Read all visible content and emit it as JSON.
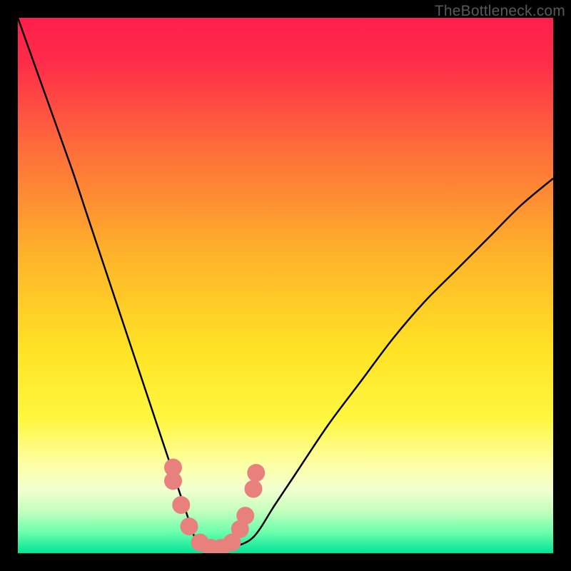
{
  "watermark": "TheBottleneck.com",
  "chart_data": {
    "type": "line",
    "title": "",
    "xlabel": "",
    "ylabel": "",
    "xlim": [
      0,
      100
    ],
    "ylim": [
      0,
      100
    ],
    "series": [
      {
        "name": "bottleneck-curve",
        "x": [
          0,
          5,
          10,
          13,
          16,
          19,
          22,
          25,
          28,
          30,
          32,
          33,
          34,
          36,
          38,
          40,
          44,
          48,
          52,
          58,
          64,
          70,
          76,
          82,
          88,
          94,
          100
        ],
        "values": [
          100,
          86,
          72,
          63,
          54,
          45,
          36,
          27,
          18,
          12,
          6,
          3,
          1,
          0,
          0,
          1,
          3,
          9,
          15,
          24,
          32,
          40,
          47,
          53,
          59,
          65,
          70
        ]
      }
    ],
    "markers": {
      "name": "highlighted-points",
      "x": [
        29,
        29,
        30.5,
        32,
        34,
        36,
        38,
        40,
        41.5,
        42.5,
        44,
        44.5
      ],
      "values": [
        16,
        13.5,
        9,
        5,
        2,
        1,
        1,
        2,
        4.5,
        7,
        12,
        15
      ]
    },
    "gradient_stops": [
      {
        "offset": 0.0,
        "color": "#ff1f4b"
      },
      {
        "offset": 0.08,
        "color": "#ff2b4a"
      },
      {
        "offset": 0.25,
        "color": "#ff6f3a"
      },
      {
        "offset": 0.45,
        "color": "#ffb52a"
      },
      {
        "offset": 0.62,
        "color": "#ffe325"
      },
      {
        "offset": 0.75,
        "color": "#fff740"
      },
      {
        "offset": 0.83,
        "color": "#fdffa0"
      },
      {
        "offset": 0.88,
        "color": "#f3ffd0"
      },
      {
        "offset": 0.92,
        "color": "#c6ffbe"
      },
      {
        "offset": 0.96,
        "color": "#6dffad"
      },
      {
        "offset": 1.0,
        "color": "#00e597"
      }
    ],
    "marker_color": "#e8807e",
    "curve_color": "#000000"
  }
}
